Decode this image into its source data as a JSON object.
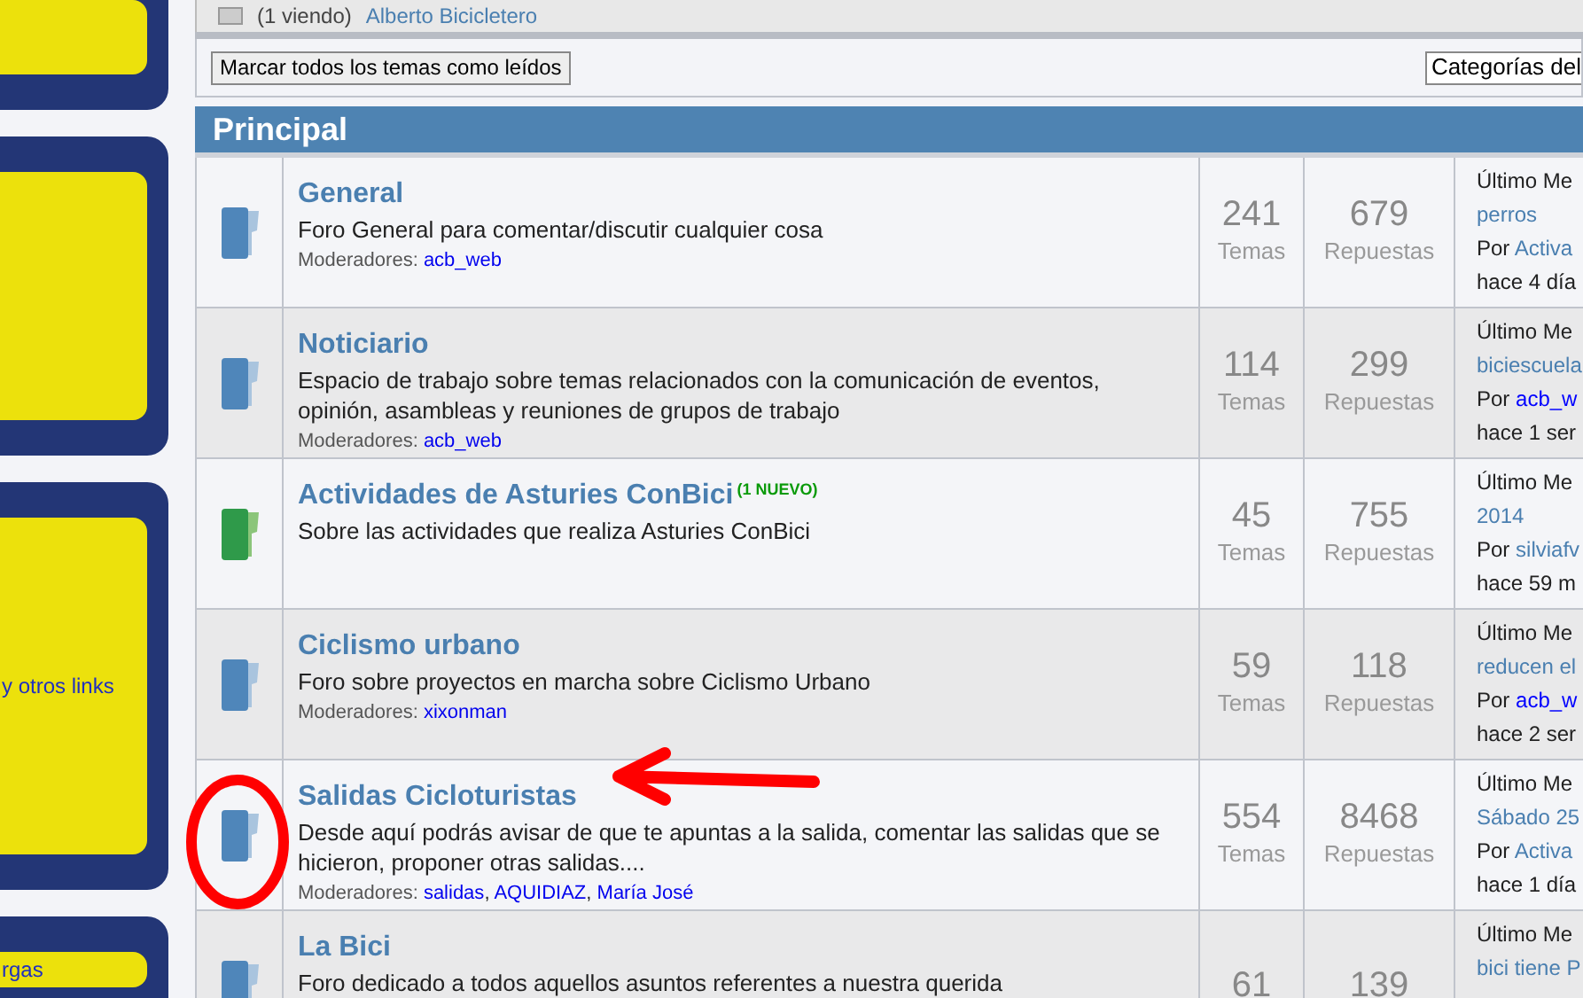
{
  "viewing": {
    "text": "(1 viendo)",
    "user": "Alberto Bicicletero"
  },
  "sidebar": {
    "panels": [
      {
        "kind": "blank"
      },
      {
        "kind": "blank"
      },
      {
        "kind": "links",
        "link": "y otros links"
      },
      {
        "kind": "links",
        "link": "rgas"
      }
    ]
  },
  "toolbar": {
    "mark_read_button": "Marcar todos los temas como leídos",
    "category_select": "Categorías del"
  },
  "section": {
    "title": "Principal"
  },
  "forums": [
    {
      "title": "General",
      "has_new": false,
      "description": "Foro General para comentar/discutir cualquier cosa",
      "moderators_label": "Moderadores:",
      "moderators": [
        "acb_web"
      ],
      "topics": "241",
      "topics_label": "Temas",
      "replies": "679",
      "replies_label": "Repuestas",
      "last_post": {
        "label": "Último Me",
        "topic": "perros",
        "by": "Por",
        "author": "Activa",
        "color": "#4a7fb0",
        "time": "hace 4 día"
      }
    },
    {
      "title": "Noticiario",
      "has_new": false,
      "description": "Espacio de trabajo sobre temas relacionados con la comunicación de eventos, opinión, asambleas y reuniones de grupos de trabajo",
      "moderators_label": "Moderadores:",
      "moderators": [
        "acb_web"
      ],
      "topics": "114",
      "topics_label": "Temas",
      "replies": "299",
      "replies_label": "Repuestas",
      "last_post": {
        "label": "Último Me",
        "topic": "biciescuela",
        "by": "Por",
        "author": "acb_w",
        "color": "#0000ff",
        "time": "hace 1 ser"
      }
    },
    {
      "title": "Actividades de Asturies ConBici",
      "has_new": true,
      "new_badge": "(1 NUEVO)",
      "description": "Sobre las actividades que realiza Asturies ConBici",
      "topics": "45",
      "topics_label": "Temas",
      "replies": "755",
      "replies_label": "Repuestas",
      "last_post": {
        "label": "Último Me",
        "topic": "2014",
        "by": "Por",
        "author": "silviafv",
        "color": "#4a7fb0",
        "time": "hace 59 m"
      }
    },
    {
      "title": "Ciclismo urbano",
      "has_new": false,
      "description": "Foro sobre proyectos en marcha sobre Ciclismo Urbano",
      "moderators_label": "Moderadores:",
      "moderators": [
        "xixonman"
      ],
      "topics": "59",
      "topics_label": "Temas",
      "replies": "118",
      "replies_label": "Repuestas",
      "last_post": {
        "label": "Último Me",
        "topic": "reducen el",
        "by": "Por",
        "author": "acb_w",
        "color": "#0000ff",
        "time": "hace 2 ser"
      }
    },
    {
      "title": "Salidas Cicloturistas",
      "has_new": false,
      "description": "Desde aquí podrás avisar de que te apuntas a la salida, comentar las salidas que se hicieron, proponer otras salidas....",
      "moderators_label": "Moderadores:",
      "moderators": [
        "salidas",
        "AQUIDIAZ",
        "María José"
      ],
      "moderators_separator": ",",
      "topics": "554",
      "topics_label": "Temas",
      "replies": "8468",
      "replies_label": "Repuestas",
      "last_post": {
        "label": "Último Me",
        "topic": "Sábado 25",
        "by": "Por",
        "author": "Activa",
        "color": "#4a7fb0",
        "time": "hace 1 día"
      }
    },
    {
      "title": "La Bici",
      "has_new": false,
      "description": "Foro dedicado a todos aquellos asuntos referentes a nuestra querida",
      "topics": "61",
      "replies": "139",
      "last_post": {
        "label": "Último Me",
        "topic": "bici tiene P"
      }
    }
  ]
}
